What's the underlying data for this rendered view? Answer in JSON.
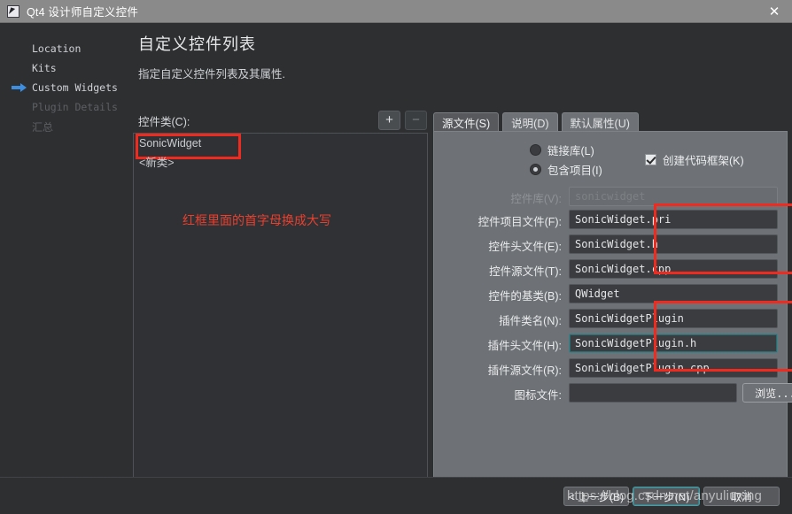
{
  "window": {
    "title": "Qt4 设计师自定义控件",
    "icon": "qt-designer-icon",
    "close_label": "✕"
  },
  "sidebar": {
    "items": [
      {
        "label": "Location",
        "state": "normal",
        "arrow": false
      },
      {
        "label": "Kits",
        "state": "normal",
        "arrow": false
      },
      {
        "label": "Custom Widgets",
        "state": "current",
        "arrow": true
      },
      {
        "label": "Plugin Details",
        "state": "disabled",
        "arrow": false
      },
      {
        "label": "汇总",
        "state": "disabled",
        "arrow": false
      }
    ]
  },
  "page": {
    "title": "自定义控件列表",
    "subtitle": "指定自定义控件列表及其属性."
  },
  "left": {
    "list_label": "控件类(C):",
    "add_button": "+",
    "remove_button": "−",
    "list_items": [
      {
        "label": "SonicWidget",
        "selected": true
      },
      {
        "label": "<新类>",
        "selected": false
      }
    ],
    "annotation": "红框里面的首字母换成大写"
  },
  "tabs": [
    {
      "label": "源文件(S)",
      "active": true
    },
    {
      "label": "说明(D)",
      "active": false
    },
    {
      "label": "默认属性(U)",
      "active": false
    }
  ],
  "panel": {
    "radios": [
      {
        "label": "链接库(L)",
        "selected": false
      },
      {
        "label": "包含项目(I)",
        "selected": true
      }
    ],
    "checkbox": {
      "label": "创建代码框架(K)",
      "checked": true
    },
    "fields": [
      {
        "label": "控件库(V):",
        "value": "sonicwidget",
        "disabled": true,
        "focused": false
      },
      {
        "label": "控件项目文件(F):",
        "value": "SonicWidget.pri",
        "disabled": false,
        "focused": false
      },
      {
        "label": "控件头文件(E):",
        "value": "SonicWidget.h",
        "disabled": false,
        "focused": false
      },
      {
        "label": "控件源文件(T):",
        "value": "SonicWidget.cpp",
        "disabled": false,
        "focused": false
      },
      {
        "label": "控件的基类(B):",
        "value": "QWidget",
        "disabled": false,
        "focused": false
      },
      {
        "label": "插件类名(N):",
        "value": "SonicWidgetPlugin",
        "disabled": false,
        "focused": false
      },
      {
        "label": "插件头文件(H):",
        "value": "SonicWidgetPlugin.h",
        "disabled": false,
        "focused": true
      },
      {
        "label": "插件源文件(R):",
        "value": "SonicWidgetPlugin.cpp",
        "disabled": false,
        "focused": false
      }
    ],
    "icon_file": {
      "label": "图标文件:",
      "value": "",
      "browse_label": "浏览..."
    }
  },
  "footer": {
    "back_label": "< 上一步(B)",
    "next_label": "下一步(N)",
    "cancel_label": "取消",
    "watermark": "https://blog.csdn.net/anyuliuxing"
  },
  "colors": {
    "accent_red": "#f02a1e",
    "titlebar": "#8a8a8a",
    "window_bg": "#2e2f31",
    "panel_bg": "#6e7175",
    "focus_teal": "#3f7f86"
  }
}
